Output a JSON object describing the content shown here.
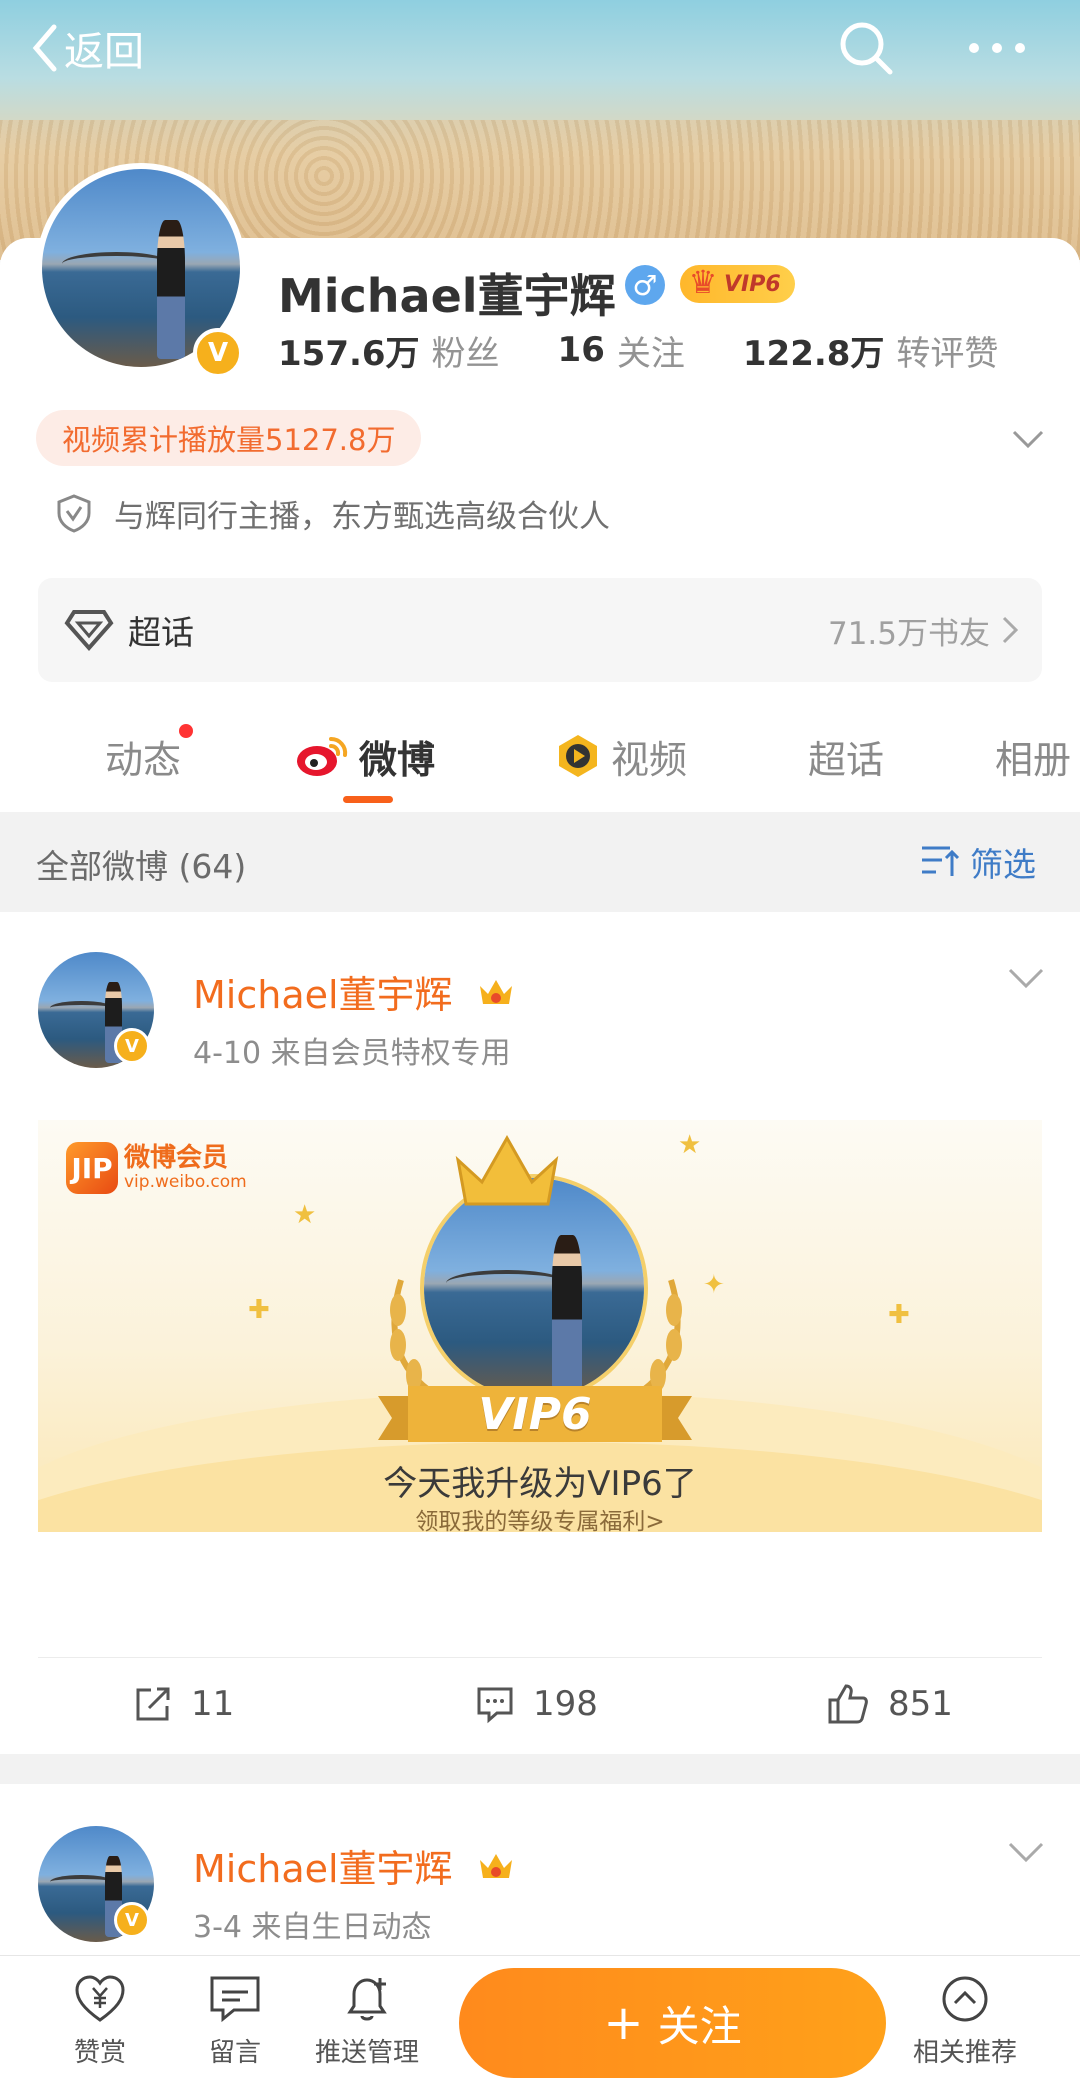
{
  "topbar": {
    "back_label": "返回",
    "search_icon": "search-icon",
    "more_icon": "more-icon"
  },
  "profile": {
    "name": "Michael董宇辉",
    "gender_symbol": "♂",
    "vip_label": "VIP6",
    "verified_mark": "V",
    "stats": [
      {
        "value": "157.6万",
        "label": "粉丝"
      },
      {
        "value": "16",
        "label": "关注"
      },
      {
        "value": "122.8万",
        "label": "转评赞"
      }
    ],
    "play_count": "视频累计播放量5127.8万",
    "verification": "与辉同行主播，东方甄选高级合伙人"
  },
  "supertopic": {
    "label": "超话",
    "count": "71.5万书友"
  },
  "tabs": [
    {
      "label": "动态",
      "has_dot": true
    },
    {
      "label": "微博",
      "active": true
    },
    {
      "label": "视频"
    },
    {
      "label": "超话"
    },
    {
      "label": "相册"
    }
  ],
  "filter": {
    "count_label": "全部微博 (64)",
    "filter_label": "筛选"
  },
  "posts": [
    {
      "author": "Michael董宇辉",
      "meta": "4-10  来自会员特权专用",
      "card": {
        "logo_mark": "JIP",
        "logo_title": "微博会员",
        "logo_url": "vip.weibo.com",
        "ribbon": "VIP6",
        "headline": "今天我升级为VIP6了",
        "sub": "领取我的等级专属福利>"
      },
      "actions": {
        "repost": "11",
        "comment": "198",
        "like": "851"
      }
    },
    {
      "author": "Michael董宇辉",
      "meta": "3-4  来自生日动态"
    }
  ],
  "bottombar": {
    "reward": "赞赏",
    "message": "留言",
    "push": "推送管理",
    "follow": "关注",
    "follow_plus": "+",
    "related": "相关推荐"
  },
  "colors": {
    "accent": "#f26c1e",
    "link": "#3f7cc7",
    "follow": "#ff931b",
    "vip_gold": "#f6b01c"
  }
}
